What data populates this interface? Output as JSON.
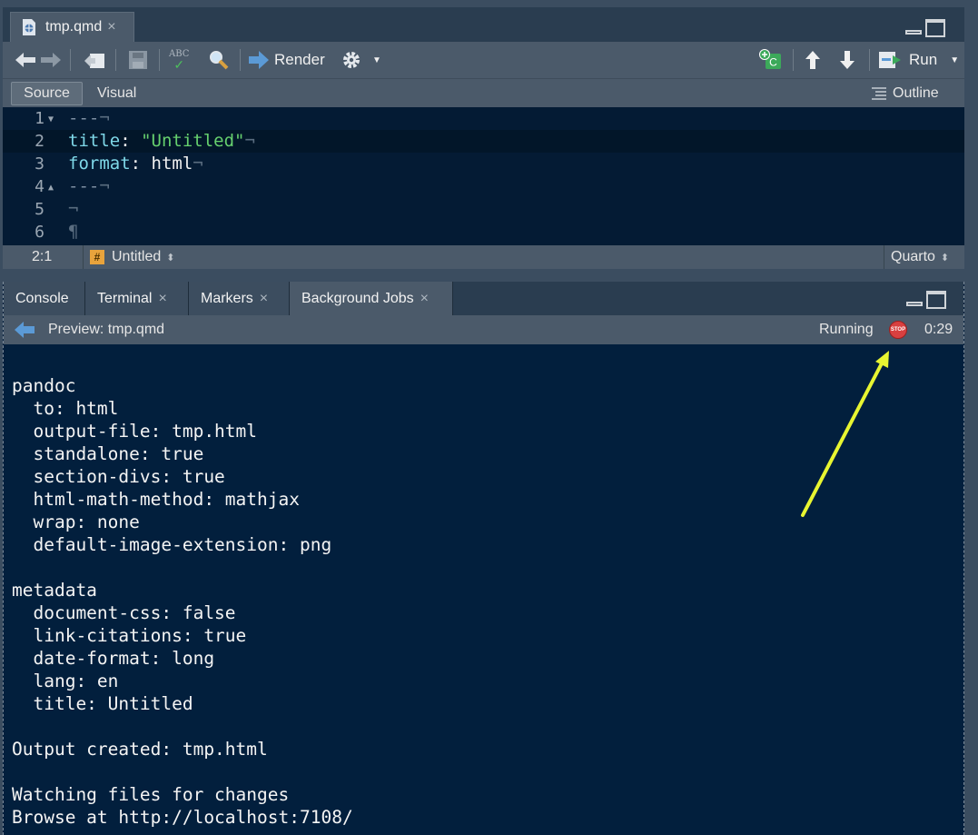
{
  "editor": {
    "tab": {
      "filename": "tmp.qmd",
      "close": "×"
    },
    "toolbar": {
      "render_label": "Render",
      "run_label": "Run",
      "spell_label": "ABC"
    },
    "modes": {
      "source": "Source",
      "visual": "Visual",
      "outline": "Outline"
    },
    "lines": [
      {
        "num": "1",
        "fold": "▼",
        "tokens": [
          {
            "cls": "c-dash",
            "text": "---"
          }
        ],
        "eol": "¬"
      },
      {
        "num": "2",
        "fold": "",
        "tokens": [
          {
            "cls": "c-key",
            "text": "title"
          },
          {
            "cls": "c-plain",
            "text": ": "
          },
          {
            "cls": "c-str",
            "text": "\"Untitled\""
          }
        ],
        "eol": "¬"
      },
      {
        "num": "3",
        "fold": "",
        "tokens": [
          {
            "cls": "c-key",
            "text": "format"
          },
          {
            "cls": "c-plain",
            "text": ": html"
          }
        ],
        "eol": "¬"
      },
      {
        "num": "4",
        "fold": "▲",
        "tokens": [
          {
            "cls": "c-dash",
            "text": "---"
          }
        ],
        "eol": "¬"
      },
      {
        "num": "5",
        "fold": "",
        "tokens": [],
        "eol": "¬"
      },
      {
        "num": "6",
        "fold": "",
        "tokens": [],
        "eol": "¶"
      }
    ],
    "status": {
      "cursor": "2:1",
      "section": "Untitled",
      "section_icon": "#",
      "filetype": "Quarto"
    }
  },
  "jobs_pane": {
    "tabs": [
      {
        "label": "Console",
        "close": ""
      },
      {
        "label": "Terminal",
        "close": "×"
      },
      {
        "label": "Markers",
        "close": "×"
      },
      {
        "label": "Background Jobs",
        "close": "×"
      }
    ],
    "job": {
      "title": "Preview: tmp.qmd",
      "state": "Running",
      "stop_text": "STOP",
      "elapsed": "0:29"
    },
    "output": [
      "pandoc",
      "  to: html",
      "  output-file: tmp.html",
      "  standalone: true",
      "  section-divs: true",
      "  html-math-method: mathjax",
      "  wrap: none",
      "  default-image-extension: png",
      "",
      "metadata",
      "  document-css: false",
      "  link-citations: true",
      "  date-format: long",
      "  lang: en",
      "  title: Untitled",
      "",
      "Output created: tmp.html",
      "",
      "Watching files for changes",
      "Browse at http://localhost:7108/"
    ]
  },
  "colors": {
    "annotation_arrow": "#e8f531",
    "stop": "#d84040",
    "editor_bg": "#041b34"
  }
}
